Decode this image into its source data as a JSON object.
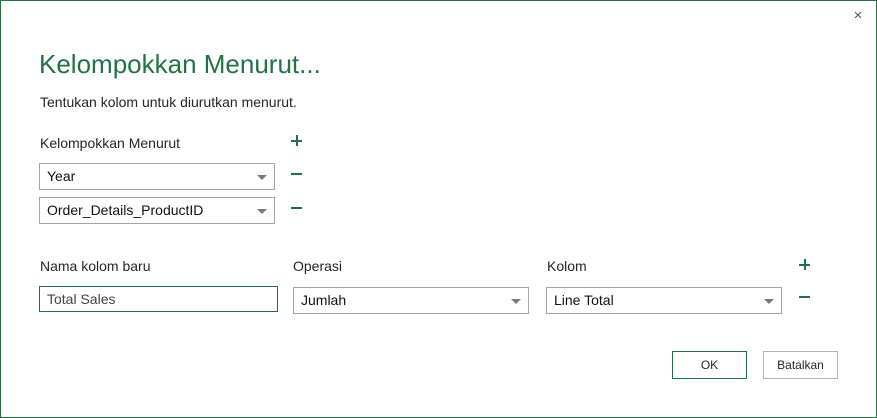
{
  "dialog": {
    "close_glyph": "×",
    "title": "Kelompokkan Menurut...",
    "subtitle": "Tentukan kolom untuk diurutkan menurut."
  },
  "group_by": {
    "label": "Kelompokkan Menurut",
    "fields": [
      {
        "value": "Year"
      },
      {
        "value": "Order_Details_ProductID"
      }
    ]
  },
  "aggregation": {
    "new_column_label": "Nama kolom baru",
    "operation_label": "Operasi",
    "column_label": "Kolom",
    "new_column_value": "Total Sales",
    "operation_value": "Jumlah",
    "column_value": "Line Total"
  },
  "buttons": {
    "ok": "OK",
    "cancel": "Batalkan"
  },
  "colors": {
    "accent": "#217346",
    "border": "#a6a6a6"
  },
  "icons": [
    "close-icon",
    "plus-icon",
    "minus-icon",
    "dropdown-caret-icon"
  ]
}
